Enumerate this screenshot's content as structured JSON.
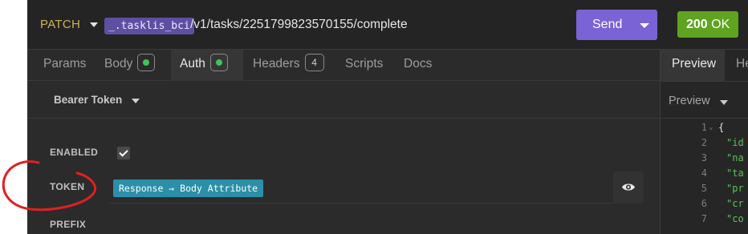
{
  "request": {
    "method": "PATCH",
    "env_tag": "_.tasklis_bci",
    "url_path": "/v1/tasks/2251799823570155/complete",
    "send_label": "Send"
  },
  "status": {
    "code": "200",
    "text": "OK",
    "color": "#5fa320"
  },
  "tabs": [
    {
      "label": "Params"
    },
    {
      "label": "Body",
      "badge": "dot"
    },
    {
      "label": "Auth",
      "badge": "dot",
      "active": true
    },
    {
      "label": "Headers",
      "badge": "4"
    },
    {
      "label": "Scripts"
    },
    {
      "label": "Docs"
    }
  ],
  "auth": {
    "type_label": "Bearer Token",
    "enabled_label": "ENABLED",
    "enabled": true,
    "token_label": "TOKEN",
    "token_chip": "Response ⇒ Body Attribute",
    "prefix_label": "PREFIX"
  },
  "response_panel": {
    "tabs": [
      "Preview",
      "He"
    ],
    "preview_mode": "Preview",
    "lines": [
      {
        "n": "1",
        "text": "{",
        "fold": true
      },
      {
        "n": "2",
        "text": "\"id"
      },
      {
        "n": "3",
        "text": "\"na"
      },
      {
        "n": "4",
        "text": "\"ta"
      },
      {
        "n": "5",
        "text": "\"pr"
      },
      {
        "n": "6",
        "text": "\"cr"
      },
      {
        "n": "7",
        "text": "\"co"
      }
    ]
  },
  "icons": [
    "method-caret-icon",
    "send-caret-icon",
    "eye-icon",
    "checkmark-icon",
    "fold-arrow-icon"
  ]
}
